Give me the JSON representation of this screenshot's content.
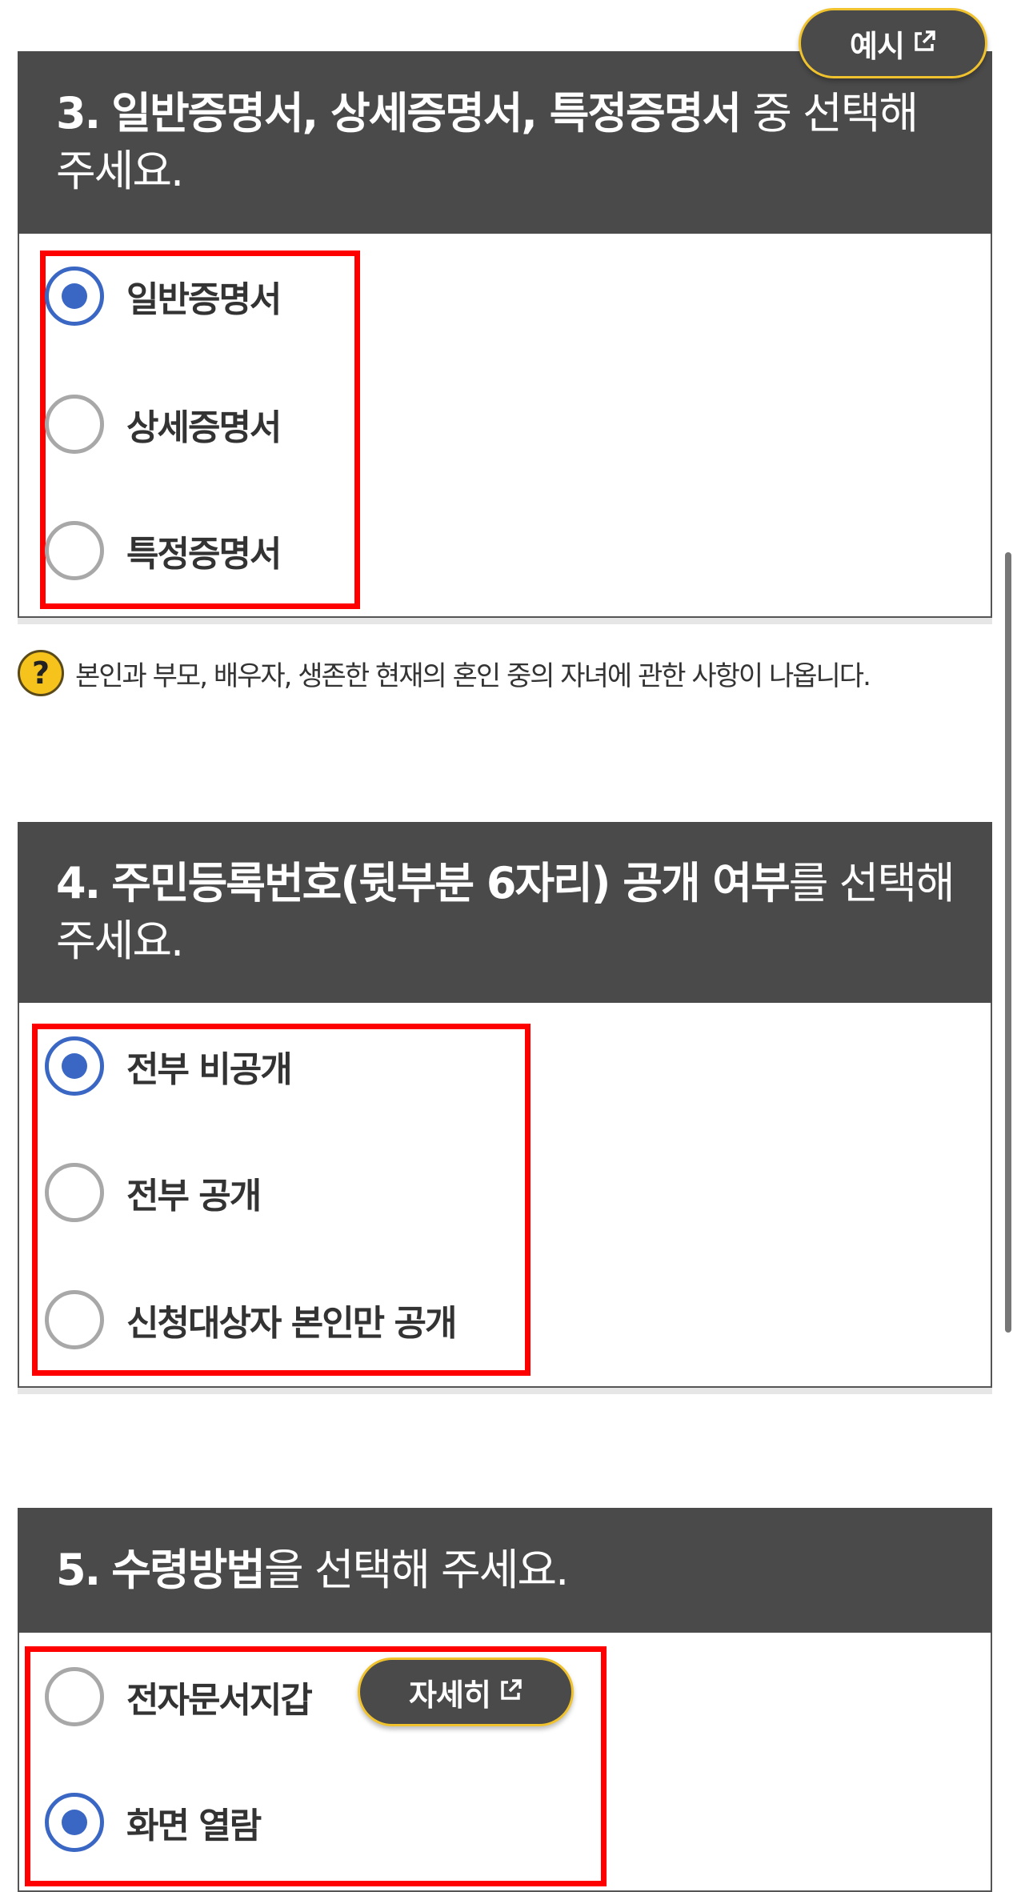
{
  "example_button": {
    "label": "예시",
    "icon": "external-link-icon"
  },
  "q3": {
    "number": "3.",
    "bold": "일반증명서, 상세증명서, 특정증명서",
    "rest": " 중 선택해 주세요.",
    "options": [
      {
        "label": "일반증명서",
        "selected": true
      },
      {
        "label": "상세증명서",
        "selected": false
      },
      {
        "label": "특정증명서",
        "selected": false
      }
    ]
  },
  "help": {
    "icon": "question-icon",
    "text": "본인과 부모, 배우자, 생존한 현재의 혼인 중의 자녀에 관한 사항이 나옵니다."
  },
  "q4": {
    "number": "4.",
    "bold": "주민등록번호(뒷부분 6자리) 공개 여부",
    "rest": "를 선택해 주세요.",
    "options": [
      {
        "label": "전부 비공개",
        "selected": true
      },
      {
        "label": "전부 공개",
        "selected": false
      },
      {
        "label": "신청대상자 본인만 공개",
        "selected": false
      }
    ]
  },
  "q5": {
    "number": "5.",
    "bold": "수령방법",
    "rest": "을 선택해 주세요.",
    "options": [
      {
        "label": "전자문서지갑",
        "selected": false
      },
      {
        "label": "화면 열람",
        "selected": true
      }
    ],
    "detail_button": {
      "label": "자세히",
      "icon": "external-link-icon"
    }
  },
  "colors": {
    "header_bg": "#4a4a4a",
    "radio_on": "#3a66c4",
    "highlight": "#ff0000",
    "pill_border": "#f0c22e"
  }
}
